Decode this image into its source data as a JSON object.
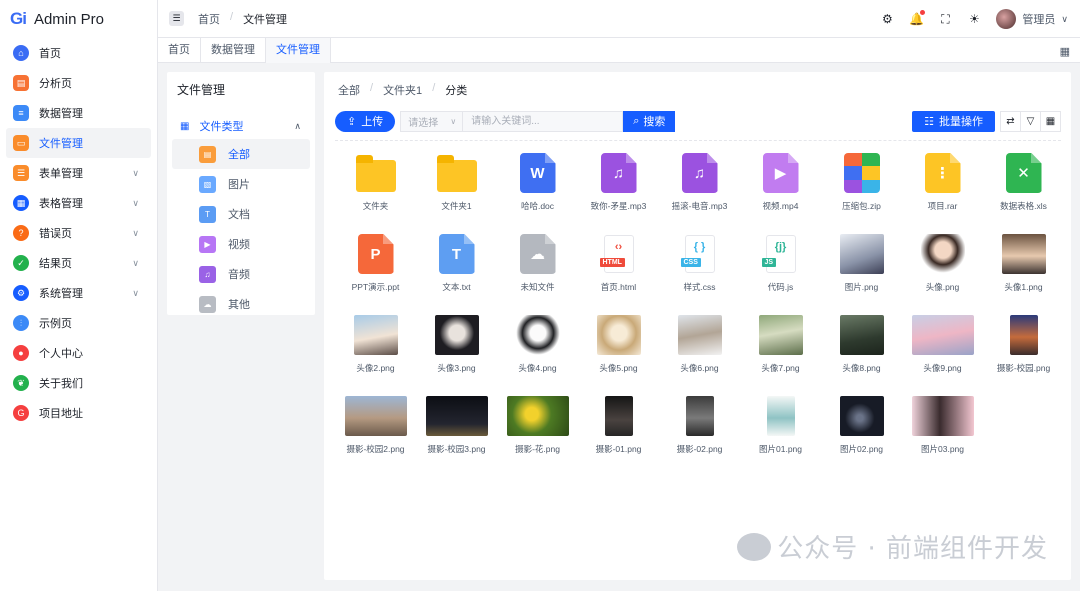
{
  "app": {
    "logo_mark": "Gi",
    "title": "Admin Pro"
  },
  "sidebar": {
    "items": [
      {
        "label": "首页",
        "icon": "home-icon",
        "color": "#3a6cf4",
        "arrow": false,
        "active": false
      },
      {
        "label": "分析页",
        "icon": "analysis-icon",
        "color": "#f77234",
        "arrow": false,
        "active": false
      },
      {
        "label": "数据管理",
        "icon": "data-icon",
        "color": "#3c8af7",
        "arrow": false,
        "active": false
      },
      {
        "label": "文件管理",
        "icon": "folder-icon",
        "color": "#fa8c2b",
        "arrow": false,
        "active": true
      },
      {
        "label": "表单管理",
        "icon": "form-icon",
        "color": "#fa8c2b",
        "arrow": true,
        "active": false
      },
      {
        "label": "表格管理",
        "icon": "table-icon",
        "color": "#165dff",
        "arrow": true,
        "active": false
      },
      {
        "label": "错误页",
        "icon": "error-icon",
        "color": "#fa6b16",
        "arrow": true,
        "active": false
      },
      {
        "label": "结果页",
        "icon": "result-icon",
        "color": "#23b14d",
        "arrow": true,
        "active": false
      },
      {
        "label": "系统管理",
        "icon": "settings-icon",
        "color": "#165dff",
        "arrow": true,
        "active": false
      },
      {
        "label": "示例页",
        "icon": "example-icon",
        "color": "#3c8af7",
        "arrow": false,
        "active": false
      },
      {
        "label": "个人中心",
        "icon": "user-icon",
        "color": "#f53f3f",
        "arrow": false,
        "active": false
      },
      {
        "label": "关于我们",
        "icon": "leaf-icon",
        "color": "#23b14d",
        "arrow": false,
        "active": false
      },
      {
        "label": "项目地址",
        "icon": "github-icon",
        "color": "#f53f3f",
        "arrow": false,
        "active": false
      }
    ]
  },
  "header": {
    "breadcrumb": [
      "首页",
      "文件管理"
    ],
    "user_name": "管理员"
  },
  "tabs": [
    {
      "label": "首页",
      "active": false
    },
    {
      "label": "数据管理",
      "active": false
    },
    {
      "label": "文件管理",
      "active": true
    }
  ],
  "tree": {
    "title": "文件管理",
    "group_label": "文件类型",
    "items": [
      {
        "label": "全部",
        "icon": "all-files-icon",
        "color": "#fa9d3c",
        "glyph": "▤",
        "active": true
      },
      {
        "label": "图片",
        "icon": "image-icon",
        "color": "#6aa9ff",
        "glyph": "▧",
        "active": false
      },
      {
        "label": "文档",
        "icon": "document-icon",
        "color": "#5b9cf4",
        "glyph": "T",
        "active": false
      },
      {
        "label": "视频",
        "icon": "video-icon",
        "color": "#b776f5",
        "glyph": "▶",
        "active": false
      },
      {
        "label": "音频",
        "icon": "audio-icon",
        "color": "#9a62e6",
        "glyph": "♫",
        "active": false
      },
      {
        "label": "其他",
        "icon": "other-icon",
        "color": "#b8bcc3",
        "glyph": "☁",
        "active": false
      }
    ]
  },
  "file_breadcrumb": [
    "全部",
    "文件夹1",
    "分类"
  ],
  "toolbar": {
    "upload_label": "上传",
    "select_placeholder": "请选择",
    "search_placeholder": "请输入关键词...",
    "search_label": "搜索",
    "batch_label": "批量操作"
  },
  "files": [
    {
      "name": "文件夹",
      "kind": "folder"
    },
    {
      "name": "文件夹1",
      "kind": "folder"
    },
    {
      "name": "哈哈.doc",
      "kind": "doc",
      "color": "#3f6ff2",
      "glyph": "W"
    },
    {
      "name": "致你-矛星.mp3",
      "kind": "doc",
      "color": "#9b52e0",
      "glyph": "♫"
    },
    {
      "name": "摇滚-电音.mp3",
      "kind": "doc",
      "color": "#9b52e0",
      "glyph": "♫"
    },
    {
      "name": "视频.mp4",
      "kind": "doc",
      "color": "#c17cf0",
      "glyph": "▶"
    },
    {
      "name": "压缩包.zip",
      "kind": "zip"
    },
    {
      "name": "项目.rar",
      "kind": "doc",
      "color": "#fdc525",
      "glyph": "⋮"
    },
    {
      "name": "数据表格.xls",
      "kind": "doc",
      "color": "#2fb552",
      "glyph": "✕"
    },
    {
      "name": "PPT演示.ppt",
      "kind": "doc",
      "color": "#f5683a",
      "glyph": "P"
    },
    {
      "name": "文本.txt",
      "kind": "doc",
      "color": "#5e9ef2",
      "glyph": "T"
    },
    {
      "name": "未知文件",
      "kind": "doc",
      "color": "#b4b8bf",
      "glyph": "☁"
    },
    {
      "name": "首页.html",
      "kind": "code",
      "color": "#ef4b3b",
      "tag": "HTML",
      "glyph": "‹›"
    },
    {
      "name": "样式.css",
      "kind": "code",
      "color": "#3ab4e8",
      "tag": "CSS",
      "glyph": "{ }"
    },
    {
      "name": "代码.js",
      "kind": "code",
      "color": "#2fb597",
      "tag": "JS",
      "glyph": "{j}"
    },
    {
      "name": "图片.png",
      "kind": "img",
      "fill": "linear-gradient(160deg,#e9edf3,#8a93a8 60%,#3c3f55)"
    },
    {
      "name": "头像.png",
      "kind": "img",
      "fill": "radial-gradient(circle at 50% 40%,#f3d7c4 25%,#3a2a24 45%,#ffffff 70%)"
    },
    {
      "name": "头像1.png",
      "kind": "img",
      "fill": "linear-gradient(180deg,#6b5340,#e7c9ae 55%,#3c3330)"
    },
    {
      "name": "头像2.png",
      "kind": "img",
      "fill": "linear-gradient(170deg,#a8cbe8,#f1e3d5 55%,#5b4d47)"
    },
    {
      "name": "头像3.png",
      "kind": "img",
      "fill": "radial-gradient(circle at 50% 45%,#e8e2dd 25%,#1e1d22 55%)"
    },
    {
      "name": "头像4.png",
      "kind": "img",
      "fill": "radial-gradient(circle at 50% 45%,#fbfbfb 25%,#202124 50%,#ffffff 70%)"
    },
    {
      "name": "头像5.png",
      "kind": "img",
      "fill": "radial-gradient(circle at 50% 45%,#f7ebd6 25%,#c9a978 55%,#f5ead8)"
    },
    {
      "name": "头像6.png",
      "kind": "img",
      "fill": "linear-gradient(170deg,#dfe4ea,#b2a596 50%,#f2f2f2)"
    },
    {
      "name": "头像7.png",
      "kind": "img",
      "fill": "linear-gradient(170deg,#8fa87a,#d6dcc1 45%,#5c6e4a)"
    },
    {
      "name": "头像8.png",
      "kind": "img",
      "fill": "linear-gradient(170deg,#6a7a66,#2e3a2e 60%,#1c241c)"
    },
    {
      "name": "头像9.png",
      "kind": "img",
      "wide": true,
      "fill": "linear-gradient(170deg,#c8cfe6,#eeb6c5 50%,#9aa3c8)"
    },
    {
      "name": "摄影-校园.png",
      "kind": "img",
      "tall": true,
      "fill": "linear-gradient(180deg,#2b3a7a,#c56b3c 55%,#3a2c2c)"
    },
    {
      "name": "摄影-校园2.png",
      "kind": "img",
      "wide": true,
      "fill": "linear-gradient(180deg,#9db6d4,#b59a82 55%,#6b5a4b)"
    },
    {
      "name": "摄影-校园3.png",
      "kind": "img",
      "wide": true,
      "fill": "linear-gradient(180deg,#0c0e14,#23252f 70%,#6a5a3a)"
    },
    {
      "name": "摄影-花.png",
      "kind": "img",
      "wide": true,
      "fill": "radial-gradient(circle at 40% 45%,#f2d12c 15%,#4d7a23 45%,#2d4a16)"
    },
    {
      "name": "摄影-01.png",
      "kind": "img",
      "tall": true,
      "fill": "linear-gradient(180deg,#151515,#4a4340 60%,#262626)"
    },
    {
      "name": "摄影-02.png",
      "kind": "img",
      "tall": true,
      "fill": "linear-gradient(180deg,#3c3c3c,#7a7a7a 55%,#2a2a2a)"
    },
    {
      "name": "图片01.png",
      "kind": "img",
      "tall": true,
      "fill": "linear-gradient(180deg,#f4f7f6,#8fc3c4 55%,#f4f7f6)"
    },
    {
      "name": "图片02.png",
      "kind": "img",
      "fill": "radial-gradient(circle at 45% 55%,#6a7388 10%,#171b26 45%)"
    },
    {
      "name": "图片03.png",
      "kind": "img",
      "wide": true,
      "fill": "linear-gradient(90deg,#f0d3db,#3a2b2e 45%,#f3c7d1)"
    }
  ],
  "watermark": "公众号 · 前端组件开发"
}
